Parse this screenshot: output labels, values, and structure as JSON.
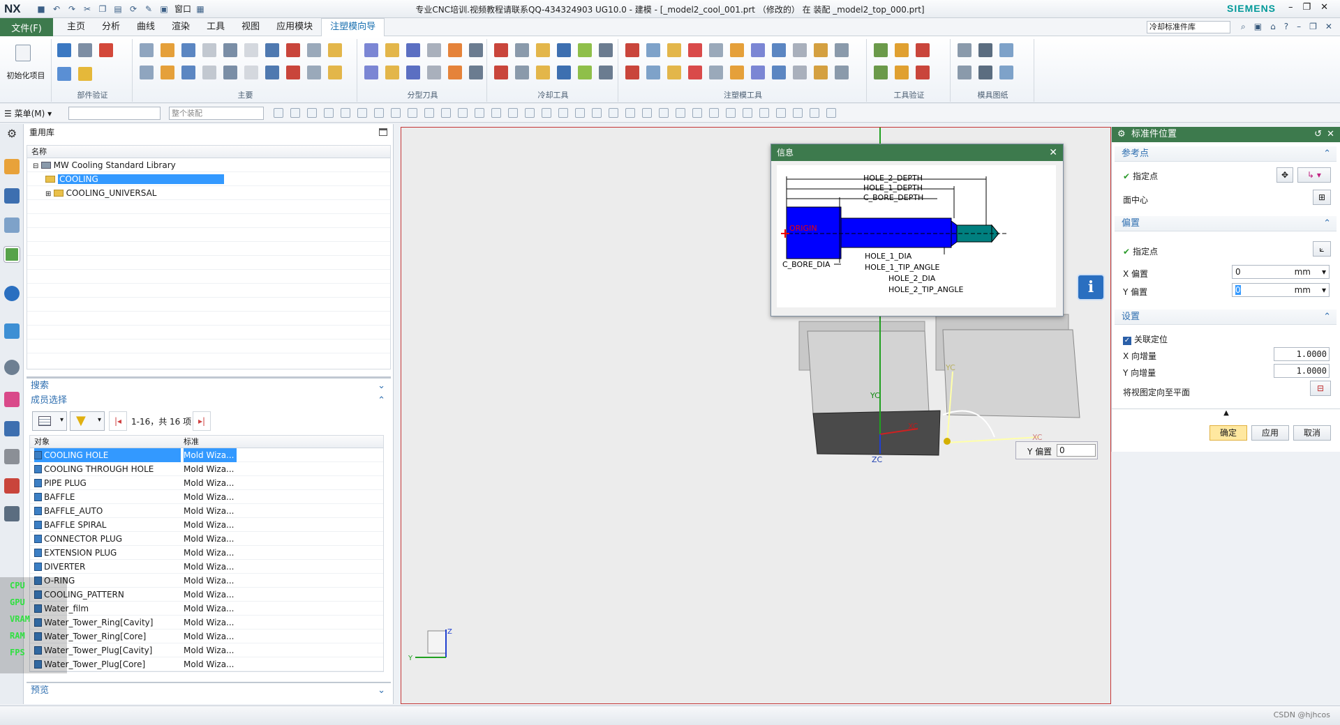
{
  "app": {
    "logo": "NX",
    "window_title": "专业CNC培训.视频教程请联系QQ-434324903 UG10.0 - 建模 - [_model2_cool_001.prt （修改的）  在 装配 _model2_top_000.prt]",
    "brand": "SIEMENS",
    "qat_window_label": "窗口"
  },
  "menu": {
    "file": "文件(F)",
    "tabs": [
      "主页",
      "分析",
      "曲线",
      "渲染",
      "工具",
      "视图",
      "应用模块",
      "注塑模向导"
    ],
    "active_tab": "注塑模向导",
    "command_search": "冷却标准件库"
  },
  "ribbon": {
    "groups": [
      "部件验证",
      "主要",
      "分型刀具",
      "冷却工具",
      "注塑模工具",
      "工具验证",
      "模具图纸"
    ],
    "init_label": "初始化项目"
  },
  "cmdbar": {
    "menu_label": "菜单(M)",
    "filter_placeholder": "",
    "scope_value": "整个装配"
  },
  "nav": {
    "title": "重用库",
    "tree_header": "名称",
    "tree": [
      {
        "label": "MW Cooling Standard Library",
        "level": 0
      },
      {
        "label": "COOLING",
        "level": 1,
        "selected": true
      },
      {
        "label": "COOLING_UNIVERSAL",
        "level": 1
      }
    ],
    "search_label": "搜索",
    "members_label": "成员选择",
    "count_text": "1-16，共 16 项",
    "list_headers": [
      "对象",
      "标准"
    ],
    "members": [
      {
        "name": "COOLING HOLE",
        "std": "Mold Wiza..."
      },
      {
        "name": "COOLING THROUGH HOLE",
        "std": "Mold Wiza..."
      },
      {
        "name": "PIPE PLUG",
        "std": "Mold Wiza..."
      },
      {
        "name": "BAFFLE",
        "std": "Mold Wiza..."
      },
      {
        "name": "BAFFLE_AUTO",
        "std": "Mold Wiza..."
      },
      {
        "name": "BAFFLE SPIRAL",
        "std": "Mold Wiza..."
      },
      {
        "name": "CONNECTOR PLUG",
        "std": "Mold Wiza..."
      },
      {
        "name": "EXTENSION PLUG",
        "std": "Mold Wiza..."
      },
      {
        "name": "DIVERTER",
        "std": "Mold Wiza..."
      },
      {
        "name": "O-RING",
        "std": "Mold Wiza..."
      },
      {
        "name": "COOLING_PATTERN",
        "std": "Mold Wiza..."
      },
      {
        "name": "Water_film",
        "std": "Mold Wiza..."
      },
      {
        "name": "Water_Tower_Ring[Cavity]",
        "std": "Mold Wiza..."
      },
      {
        "name": "Water_Tower_Ring[Core]",
        "std": "Mold Wiza..."
      },
      {
        "name": "Water_Tower_Plug[Cavity]",
        "std": "Mold Wiza..."
      },
      {
        "name": "Water_Tower_Plug[Core]",
        "std": "Mold Wiza..."
      }
    ],
    "preview_label": "预览"
  },
  "hud": [
    "CPU",
    "GPU",
    "VRAM",
    "RAM",
    "FPS"
  ],
  "info": {
    "title": "信息",
    "labels": {
      "hole2_depth": "HOLE_2_DEPTH",
      "hole1_depth": "HOLE_1_DEPTH",
      "cbore_depth": "C_BORE_DEPTH",
      "origin": "ORIGIN",
      "cbore_dia": "C_BORE_DIA",
      "hole1_dia": "HOLE_1_DIA",
      "hole1_tip": "HOLE_1_TIP_ANGLE",
      "hole2_dia": "HOLE_2_DIA",
      "hole2_tip": "HOLE_2_TIP_ANGLE"
    }
  },
  "viewport": {
    "axis_labels": {
      "yc": "YC",
      "xc": "XC",
      "zc": "ZC",
      "yc2": "YC",
      "xc2": "XC"
    },
    "y_offset_label": "Y 偏置",
    "y_offset_value": "0",
    "triad": {
      "y": "Y",
      "z": "Z"
    }
  },
  "props": {
    "title": "标准件位置",
    "sec_ref": "参考点",
    "specify_point": "指定点",
    "face_center": "面中心",
    "sec_offset": "偏置",
    "specify_point2": "指定点",
    "x_offset_label": "X 偏置",
    "x_offset_value": "0",
    "y_offset_label": "Y 偏置",
    "y_offset_value": "0",
    "unit": "mm",
    "sec_settings": "设置",
    "assoc_label": "关联定位",
    "x_incr_label": "X 向增量",
    "x_incr_value": "1.0000",
    "y_incr_label": "Y 向增量",
    "y_incr_value": "1.0000",
    "orient_label": "将视图定向至平面",
    "ok": "确定",
    "apply": "应用",
    "cancel": "取消"
  },
  "status": {
    "watermark": "CSDN @hjhcos"
  }
}
